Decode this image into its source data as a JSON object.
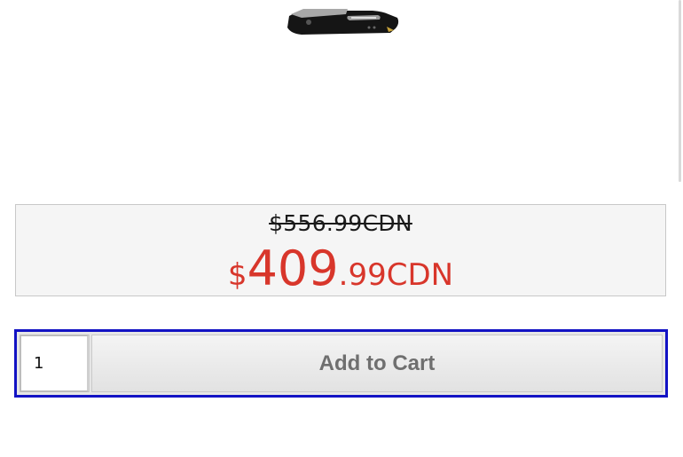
{
  "product": {
    "image_icon": "folding-knife-image"
  },
  "pricing": {
    "old_price": "$556.99CDN",
    "new_price_currency": "$",
    "new_price_dollars": "409",
    "new_price_cents": ".99CDN",
    "new_price_color": "#d8362b"
  },
  "cart": {
    "quantity_value": "1",
    "add_to_cart_label": "Add to Cart",
    "focus_border_color": "#1212c4"
  }
}
